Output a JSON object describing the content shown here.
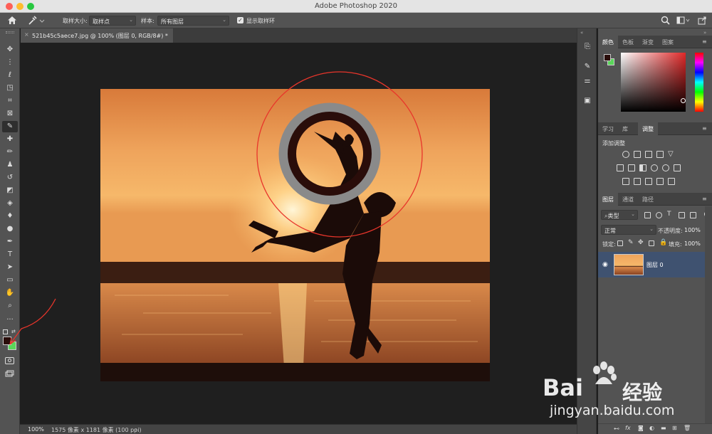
{
  "app": {
    "title": "Adobe Photoshop 2020"
  },
  "options_bar": {
    "sample_size_label": "取样大小:",
    "sample_size_value": "取样点",
    "sample_label": "样本:",
    "sample_value": "所有图层",
    "show_ring_label": "显示取样环",
    "show_ring_checked": true
  },
  "document": {
    "tab_title": "521b45c5aece7.jpg @ 100% (图层 0, RGB/8#) *",
    "close": "×"
  },
  "status": {
    "zoom": "100%",
    "info": "1575 像素 x 1181 像素 (100 ppi)",
    "arrow": "›"
  },
  "color_panel": {
    "tabs": [
      "颜色",
      "色板",
      "渐变",
      "图案"
    ],
    "active": "颜色",
    "foreground": "#2a0d0a",
    "background": "#5ad65a",
    "hue_color": "#e02828"
  },
  "adjust_panel": {
    "tabs": [
      "学习",
      "库",
      "调整"
    ],
    "active": "调整",
    "add_label": "添加调整"
  },
  "layers_panel": {
    "tabs": [
      "图层",
      "通道",
      "路径"
    ],
    "active": "图层",
    "filter_kind": "类型",
    "blend_mode": "正常",
    "opacity_label": "不透明度:",
    "opacity_value": "100%",
    "lock_label": "锁定:",
    "fill_label": "填充:",
    "fill_value": "100%",
    "layer_name": "图层 0"
  },
  "watermark": {
    "logo": "Bai",
    "logo_cn": "经验",
    "url": "jingyan.baidu.com"
  },
  "colors": {
    "titlebar": "#e4e4e4",
    "panel": "#535353",
    "dark": "#1f1f1f",
    "annotation": "#e8352b"
  }
}
